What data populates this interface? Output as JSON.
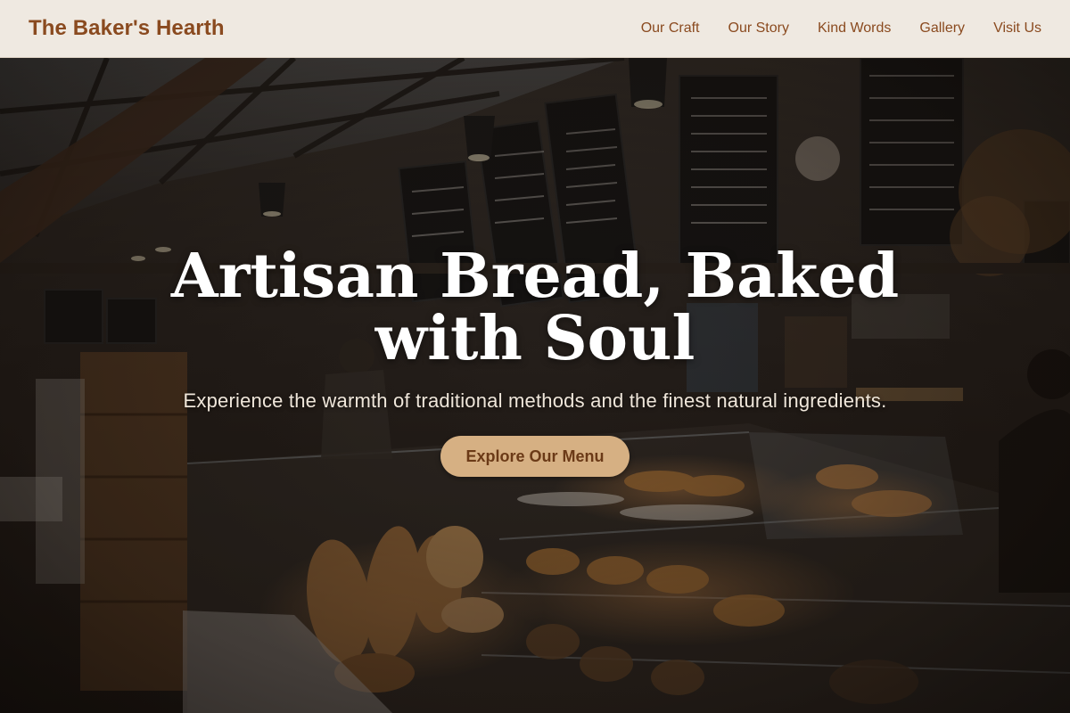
{
  "brand": {
    "name": "The Baker's Hearth"
  },
  "nav": {
    "items": [
      {
        "label": "Our Craft"
      },
      {
        "label": "Our Story"
      },
      {
        "label": "Kind Words"
      },
      {
        "label": "Gallery"
      },
      {
        "label": "Visit Us"
      }
    ]
  },
  "hero": {
    "title": "Artisan Bread, Baked with Soul",
    "subtitle": "Experience the warmth of traditional methods and the finest natural ingredients.",
    "cta_label": "Explore Our Menu"
  },
  "colors": {
    "header_bg": "#efe9e1",
    "brand": "#8a4a1f",
    "cta_bg": "#d6b083",
    "cta_text": "#6b3a17"
  }
}
